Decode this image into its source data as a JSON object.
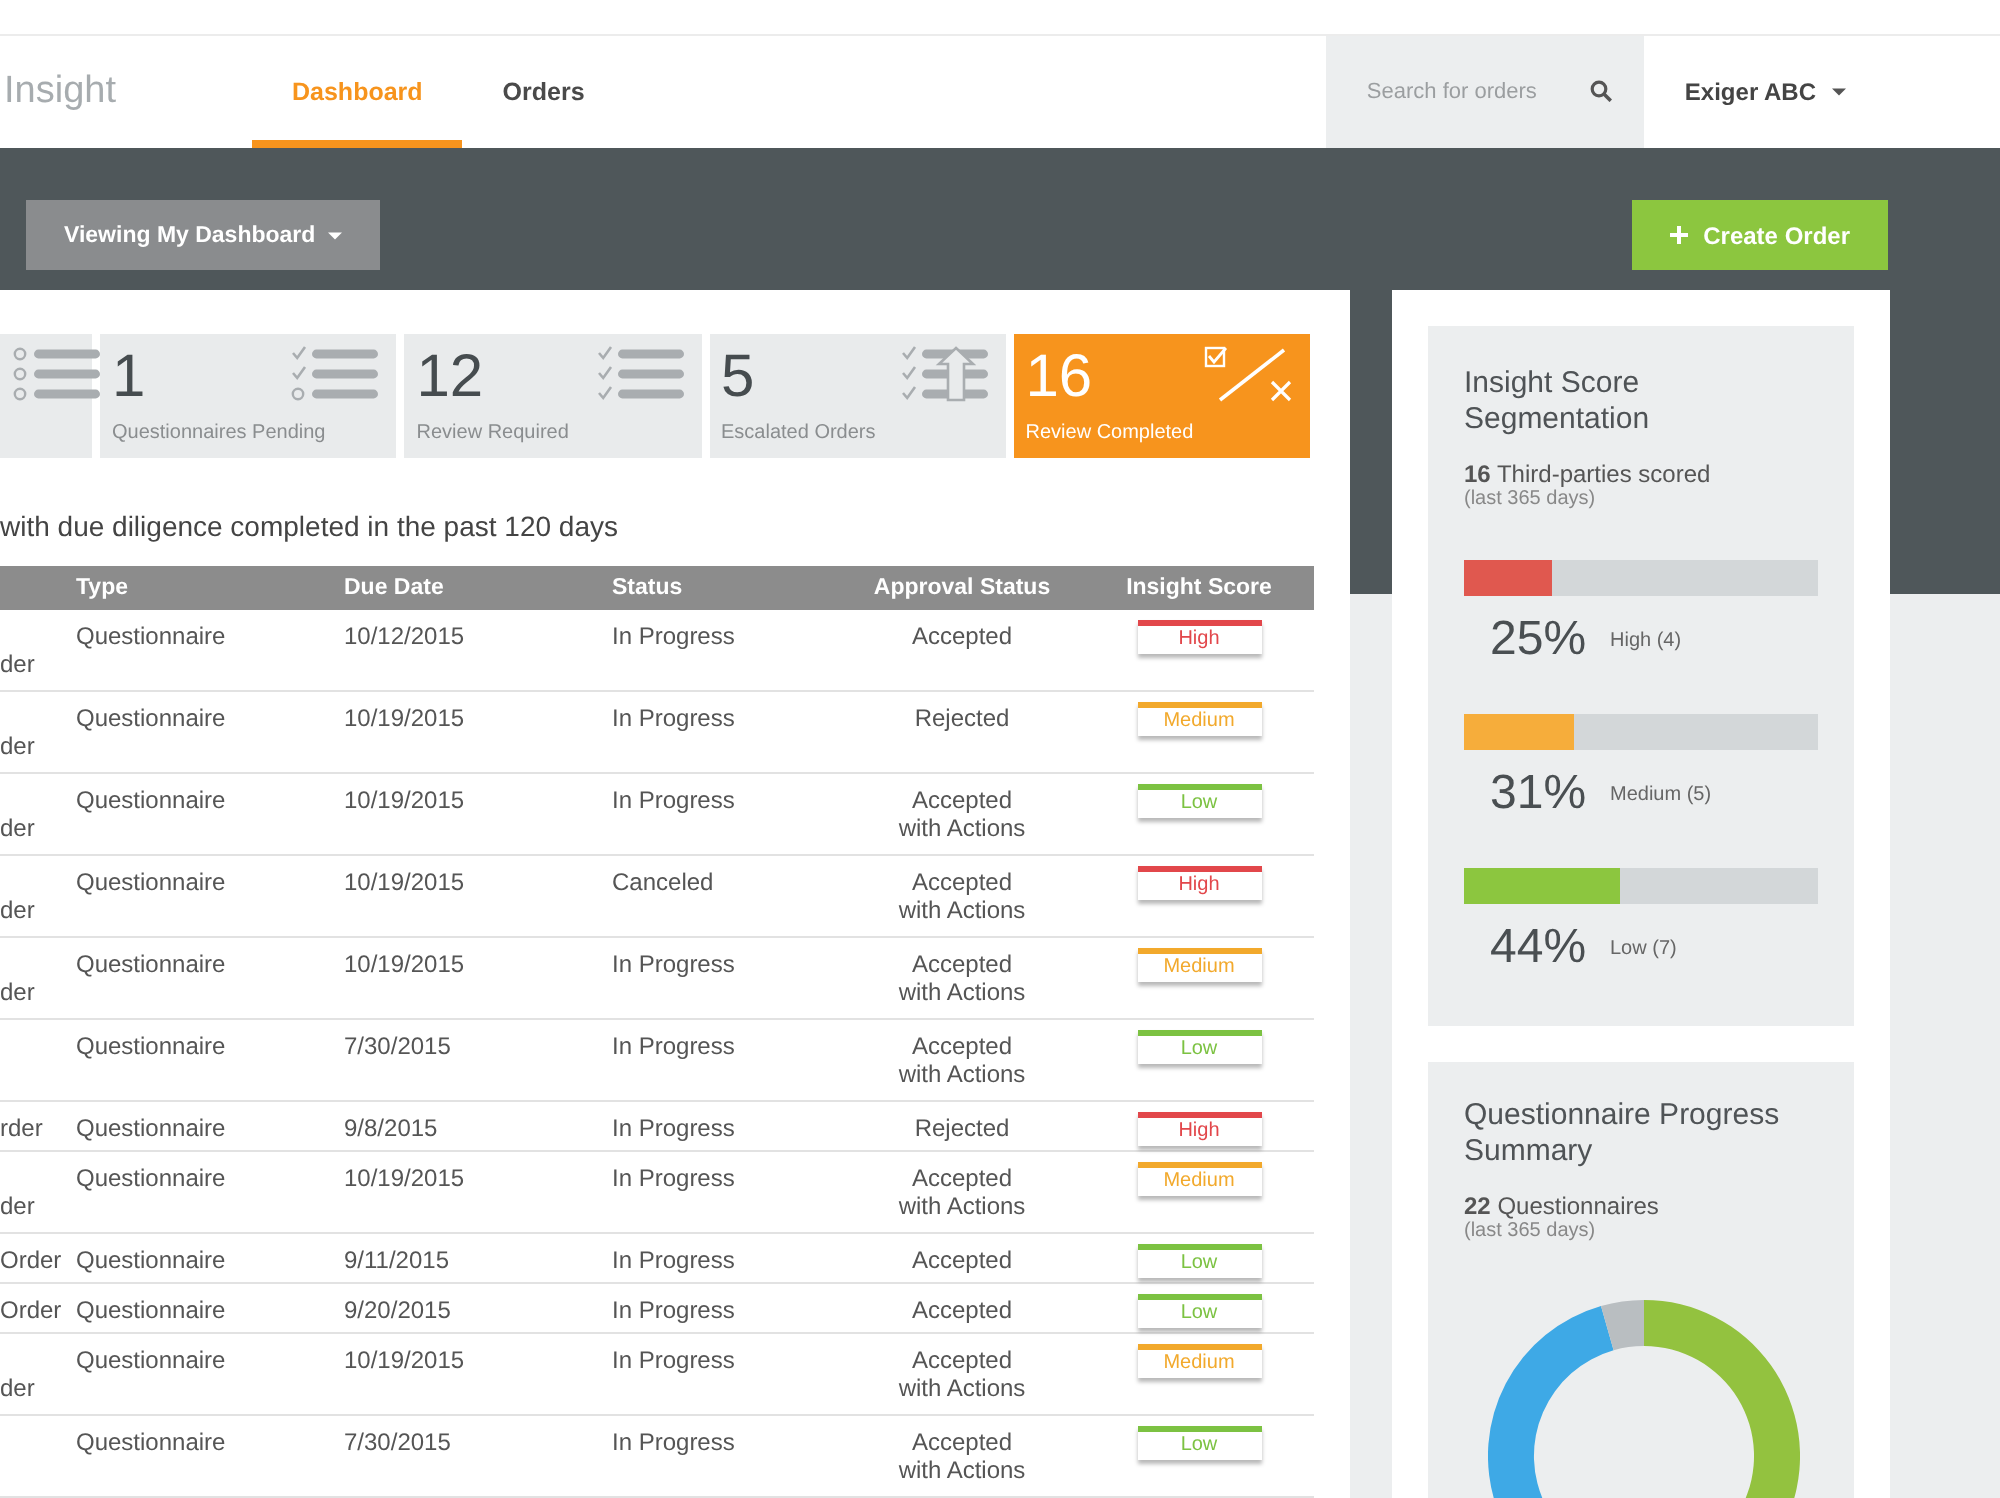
{
  "header": {
    "logo": "Insight",
    "nav": [
      {
        "label": "Dashboard",
        "selected": true
      },
      {
        "label": "Orders",
        "selected": false
      }
    ],
    "search": {
      "placeholder": "Search for orders"
    },
    "account": "Exiger ABC"
  },
  "toolbar": {
    "view_menu": "Viewing My Dashboard",
    "create_button": "Create Order"
  },
  "stats": [
    {
      "selected": false
    },
    {
      "value": "1",
      "label": "Questionnaires Pending",
      "selected": false
    },
    {
      "value": "12",
      "label": "Review Required",
      "selected": false
    },
    {
      "value": "5",
      "label": "Escalated Orders",
      "selected": false
    },
    {
      "value": "16",
      "label": "Review Completed",
      "selected": true
    }
  ],
  "orders": {
    "caption": "with due diligence completed in the past 120 days",
    "columns": [
      "Type",
      "Due Date",
      "Status",
      "Approval Status",
      "Insight Score"
    ],
    "rows": [
      {
        "kind": "double",
        "column_1": "der",
        "type": "Questionnaire",
        "due_date": "10/12/2015",
        "status": "In Progress",
        "approval_status": "Accepted",
        "insight_score": {
          "label": "High",
          "color": "#e2474b"
        }
      },
      {
        "kind": "double",
        "column_1": "der",
        "type": "Questionnaire",
        "due_date": "10/19/2015",
        "status": "In Progress",
        "approval_status": "Rejected",
        "insight_score": {
          "label": "Medium",
          "color": "#f2a92c"
        }
      },
      {
        "kind": "double",
        "column_1": "der",
        "type": "Questionnaire",
        "due_date": "10/19/2015",
        "status": "In Progress",
        "approval_status": "Accepted with Actions",
        "insight_score": {
          "label": "Low",
          "color": "#7cc242"
        }
      },
      {
        "kind": "double",
        "column_1": "der",
        "type": "Questionnaire",
        "due_date": "10/19/2015",
        "status": "Canceled",
        "approval_status": "Accepted with Actions",
        "insight_score": {
          "label": "High",
          "color": "#e2474b"
        }
      },
      {
        "kind": "double",
        "column_1": "der",
        "type": "Questionnaire",
        "due_date": "10/19/2015",
        "status": "In Progress",
        "approval_status": "Accepted with Actions",
        "insight_score": {
          "label": "Medium",
          "color": "#f2a92c"
        }
      },
      {
        "kind": "double",
        "type": "Questionnaire",
        "due_date": "7/30/2015",
        "status": "In Progress",
        "approval_status": "Accepted with Actions",
        "insight_score": {
          "label": "Low",
          "color": "#7cc242"
        }
      },
      {
        "kind": "single",
        "column_1": "rder",
        "type": "Questionnaire",
        "due_date": "9/8/2015",
        "status": "In Progress",
        "approval_status": "Rejected",
        "insight_score": {
          "label": "High",
          "color": "#e2474b"
        }
      },
      {
        "kind": "double",
        "column_1": "der",
        "type": "Questionnaire",
        "due_date": "10/19/2015",
        "status": "In Progress",
        "approval_status": "Accepted with Actions",
        "insight_score": {
          "label": "Medium",
          "color": "#f2a92c"
        }
      },
      {
        "kind": "single",
        "column_1": "Order",
        "type": "Questionnaire",
        "due_date": "9/11/2015",
        "status": "In Progress",
        "approval_status": "Accepted",
        "insight_score": {
          "label": "Low",
          "color": "#7cc242"
        }
      },
      {
        "kind": "single",
        "column_1": "Order",
        "type": "Questionnaire",
        "due_date": "9/20/2015",
        "status": "In Progress",
        "approval_status": "Accepted",
        "insight_score": {
          "label": "Low",
          "color": "#7cc242"
        }
      },
      {
        "kind": "double",
        "column_1": "der",
        "type": "Questionnaire",
        "due_date": "10/19/2015",
        "status": "In Progress",
        "approval_status": "Accepted with Actions",
        "insight_score": {
          "label": "Medium",
          "color": "#f2a92c"
        }
      },
      {
        "kind": "double",
        "type": "Questionnaire",
        "due_date": "7/30/2015",
        "status": "In Progress",
        "approval_status": "Accepted with Actions",
        "insight_score": {
          "label": "Low",
          "color": "#7cc242"
        }
      }
    ]
  },
  "segmentation": {
    "title": "Insight Score Segmentation",
    "count": "**16** Third-parties scored",
    "period": "(last 365 days)",
    "bars": [
      {
        "level": 0.25,
        "color": "#e0584f",
        "percent": "25%",
        "label": "High (4)"
      },
      {
        "level": 0.31,
        "color": "#f6ad3b",
        "percent": "31%",
        "label": "Medium (5)"
      },
      {
        "level": 0.44,
        "color": "#8cc63f",
        "percent": "44%",
        "label": "Low (7)"
      }
    ]
  },
  "progress_summary": {
    "title": "Questionnaire Progress Summary",
    "count": "**22** Questionnaires",
    "period": "(last 365 days)"
  }
}
